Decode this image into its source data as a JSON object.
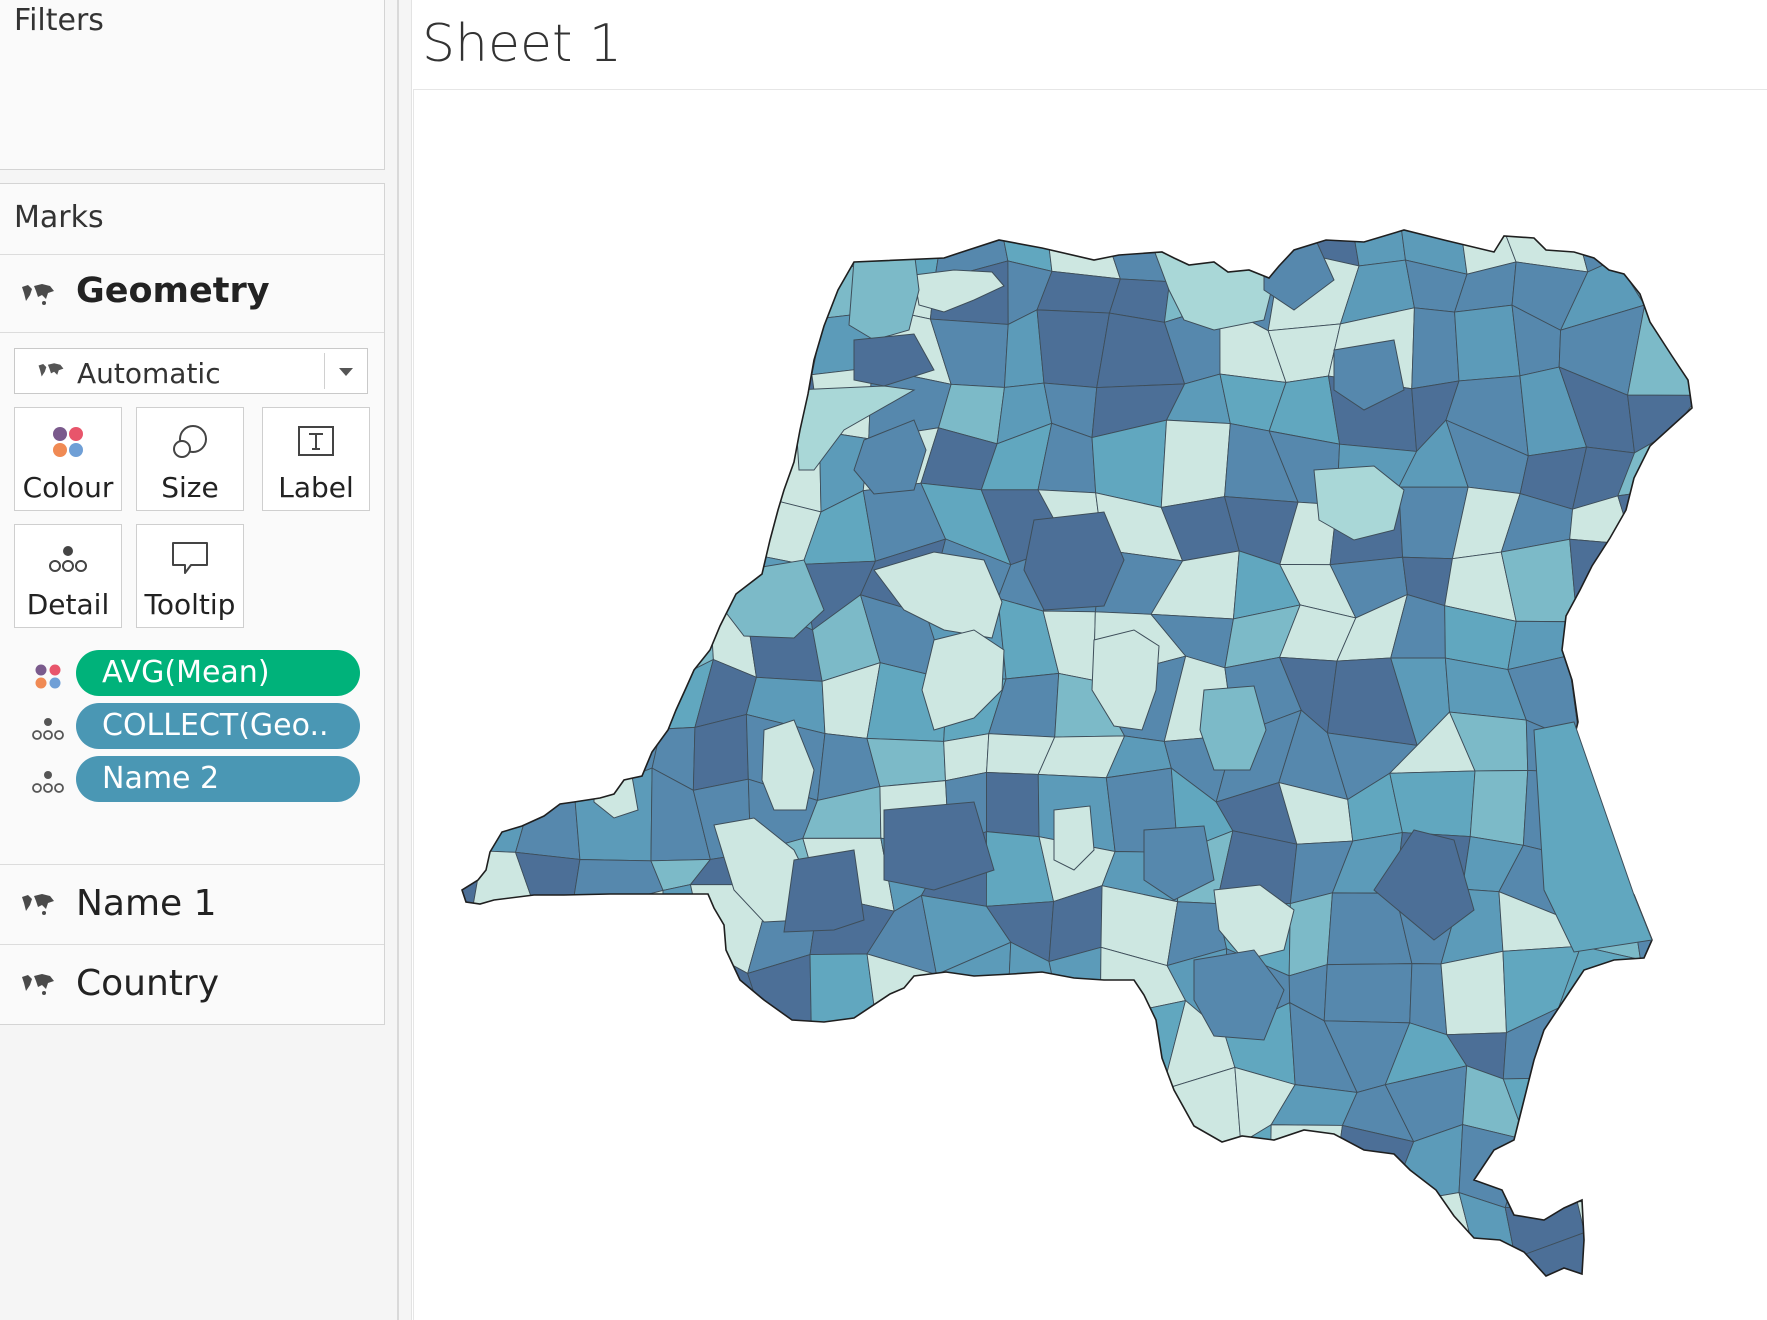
{
  "filters": {
    "title": "Filters"
  },
  "marks": {
    "title": "Marks",
    "geometry_label": "Geometry",
    "mark_type": "Automatic",
    "buttons": [
      {
        "label": "Colour",
        "icon": "colour-icon"
      },
      {
        "label": "Size",
        "icon": "size-icon"
      },
      {
        "label": "Label",
        "icon": "label-icon"
      },
      {
        "label": "Detail",
        "icon": "detail-icon"
      },
      {
        "label": "Tooltip",
        "icon": "tooltip-icon"
      }
    ],
    "pills": [
      {
        "label": "AVG(Mean)",
        "type": "colour",
        "color": "#00b27a"
      },
      {
        "label": "COLLECT(Geo..",
        "type": "detail",
        "color": "#4a97b4"
      },
      {
        "label": "Name 2",
        "type": "detail",
        "color": "#4a97b4"
      }
    ],
    "sub_layers": [
      {
        "label": "Name 1",
        "icon": "map-icon"
      },
      {
        "label": "Country",
        "icon": "map-icon"
      }
    ]
  },
  "sheet": {
    "title": "Sheet 1"
  },
  "map": {
    "palette": [
      "#cde7e1",
      "#a9d7d7",
      "#7cbac8",
      "#61a7bf",
      "#5c9bb9",
      "#5688ad",
      "#4c6f97"
    ]
  }
}
